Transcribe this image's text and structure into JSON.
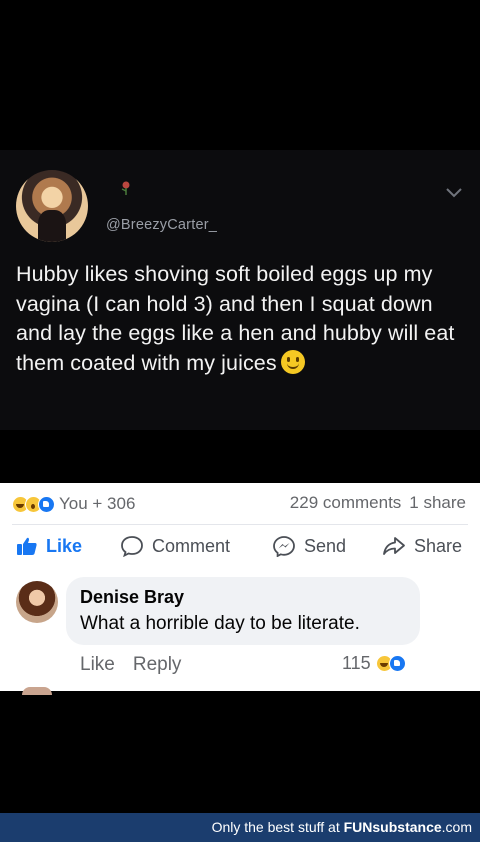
{
  "tweet": {
    "handle": "@BreezyCarter_",
    "text": "Hubby likes shoving soft boiled eggs up my vagina (I can hold 3) and then I squat down and lay the eggs like a hen and hubby will eat them coated with my juices",
    "avatar_icon": "profile-photo",
    "emoji_icon": "slightly-smiling-face-emoji"
  },
  "post": {
    "reactions_label": "You + 306",
    "comments_label": "229 comments",
    "shares_label": "1 share",
    "actions": {
      "like": "Like",
      "comment": "Comment",
      "send": "Send",
      "share": "Share"
    },
    "accent_color": "#1877f2"
  },
  "comment": {
    "author": "Denise Bray",
    "text": "What a horrible day to be literate.",
    "like_label": "Like",
    "reply_label": "Reply",
    "reaction_count": "115"
  },
  "footer": {
    "tagline": "Only the best stuff at ",
    "brand": "FUNsubstance",
    "domain": ".com"
  }
}
